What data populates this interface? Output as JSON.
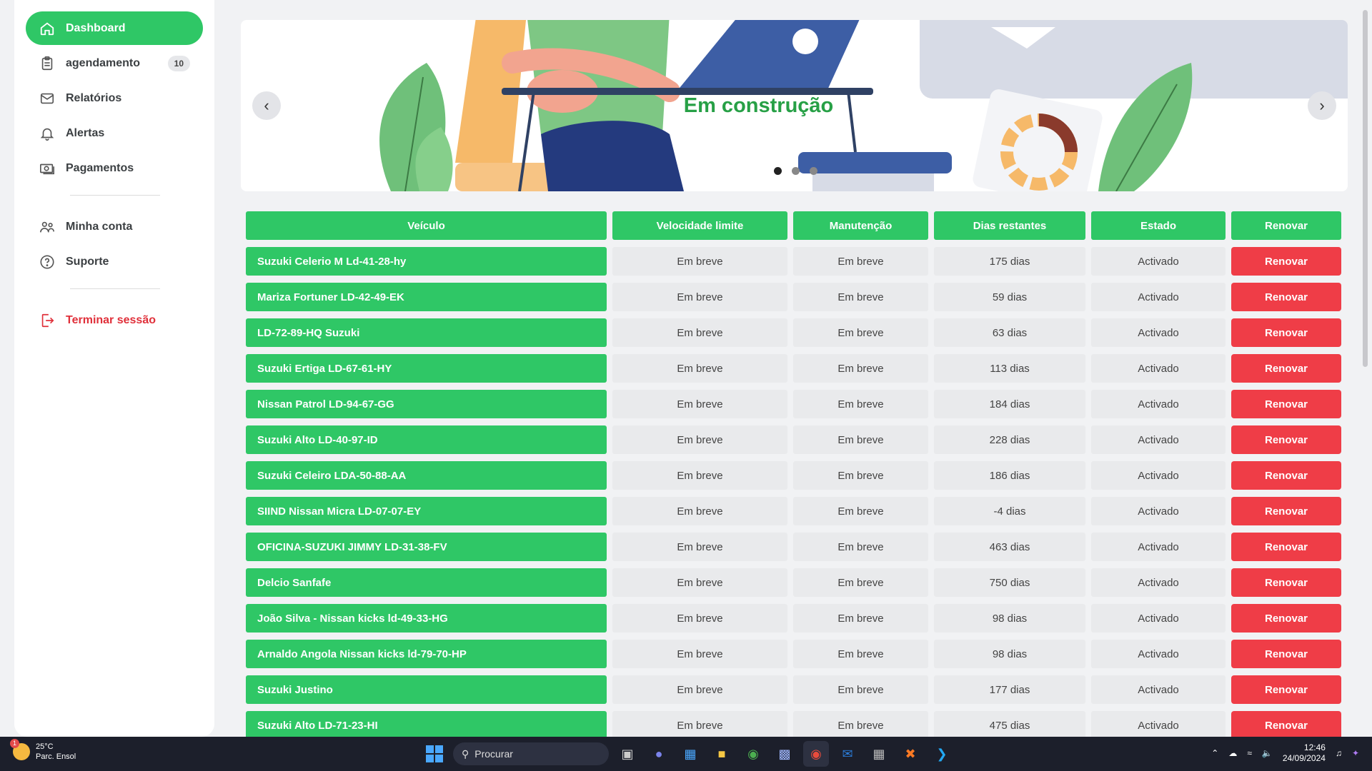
{
  "sidebar": {
    "items": [
      {
        "label": "Dashboard",
        "icon": "home-icon",
        "active": true
      },
      {
        "label": "agendamento",
        "icon": "clipboard-icon",
        "badge": "10"
      },
      {
        "label": "Relatórios",
        "icon": "mail-icon"
      },
      {
        "label": "Alertas",
        "icon": "bell-icon"
      },
      {
        "label": "Pagamentos",
        "icon": "money-icon"
      }
    ],
    "account_items": [
      {
        "label": "Minha conta",
        "icon": "users-icon"
      },
      {
        "label": "Suporte",
        "icon": "help-icon"
      }
    ],
    "logout": {
      "label": "Terminar sessão",
      "icon": "logout-icon"
    }
  },
  "carousel": {
    "title": "Em construção",
    "active_slide": 1,
    "slide_count": 3
  },
  "table": {
    "headers": [
      "Veículo",
      "Velocidade limite",
      "Manutenção",
      "Dias restantes",
      "Estado",
      "Renovar"
    ],
    "rows": [
      {
        "vehicle": "Suzuki Celerio M Ld-41-28-hy",
        "speed": "Em breve",
        "maintenance": "Em breve",
        "days": "175 dias",
        "status": "Activado",
        "action": "Renovar"
      },
      {
        "vehicle": "Mariza Fortuner LD-42-49-EK",
        "speed": "Em breve",
        "maintenance": "Em breve",
        "days": "59 dias",
        "status": "Activado",
        "action": "Renovar"
      },
      {
        "vehicle": "LD-72-89-HQ Suzuki",
        "speed": "Em breve",
        "maintenance": "Em breve",
        "days": "63 dias",
        "status": "Activado",
        "action": "Renovar"
      },
      {
        "vehicle": "Suzuki Ertiga LD-67-61-HY",
        "speed": "Em breve",
        "maintenance": "Em breve",
        "days": "113 dias",
        "status": "Activado",
        "action": "Renovar"
      },
      {
        "vehicle": "Nissan Patrol LD-94-67-GG",
        "speed": "Em breve",
        "maintenance": "Em breve",
        "days": "184 dias",
        "status": "Activado",
        "action": "Renovar"
      },
      {
        "vehicle": "Suzuki Alto LD-40-97-ID",
        "speed": "Em breve",
        "maintenance": "Em breve",
        "days": "228 dias",
        "status": "Activado",
        "action": "Renovar"
      },
      {
        "vehicle": "Suzuki Celeiro LDA-50-88-AA",
        "speed": "Em breve",
        "maintenance": "Em breve",
        "days": "186 dias",
        "status": "Activado",
        "action": "Renovar"
      },
      {
        "vehicle": "SIIND Nissan Micra LD-07-07-EY",
        "speed": "Em breve",
        "maintenance": "Em breve",
        "days": "-4 dias",
        "status": "Activado",
        "action": "Renovar"
      },
      {
        "vehicle": "OFICINA-SUZUKI JIMMY LD-31-38-FV",
        "speed": "Em breve",
        "maintenance": "Em breve",
        "days": "463 dias",
        "status": "Activado",
        "action": "Renovar"
      },
      {
        "vehicle": "Delcio Sanfafe",
        "speed": "Em breve",
        "maintenance": "Em breve",
        "days": "750 dias",
        "status": "Activado",
        "action": "Renovar"
      },
      {
        "vehicle": "João Silva - Nissan kicks ld-49-33-HG",
        "speed": "Em breve",
        "maintenance": "Em breve",
        "days": "98 dias",
        "status": "Activado",
        "action": "Renovar"
      },
      {
        "vehicle": "Arnaldo Angola Nissan kicks ld-79-70-HP",
        "speed": "Em breve",
        "maintenance": "Em breve",
        "days": "98 dias",
        "status": "Activado",
        "action": "Renovar"
      },
      {
        "vehicle": "Suzuki Justino",
        "speed": "Em breve",
        "maintenance": "Em breve",
        "days": "177 dias",
        "status": "Activado",
        "action": "Renovar"
      },
      {
        "vehicle": "Suzuki Alto LD-71-23-HI",
        "speed": "Em breve",
        "maintenance": "Em breve",
        "days": "475 dias",
        "status": "Activado",
        "action": "Renovar"
      }
    ]
  },
  "taskbar": {
    "weather_temp": "25°C",
    "weather_desc": "Parc. Ensol",
    "weather_alert": "1",
    "search_placeholder": "Procurar",
    "time": "12:46",
    "date": "24/09/2024"
  },
  "colors": {
    "accent_green": "#2fc766",
    "danger_red": "#ef3d47",
    "title_green": "#27a046"
  }
}
